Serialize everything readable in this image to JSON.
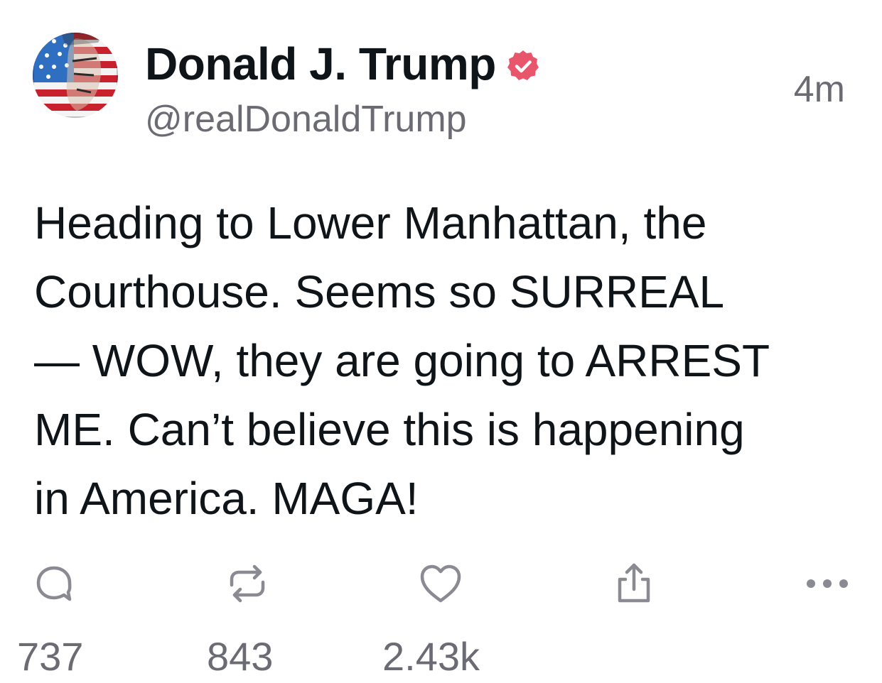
{
  "post": {
    "author_name": "Donald J. Trump",
    "handle": "@realDonaldTrump",
    "timestamp": "4m",
    "verified": true,
    "text": "Heading to Lower Manhattan, the\nCourthouse. Seems so SURREAL\n— WOW, they are going to ARREST\nME. Can’t believe this is happening\nin America. MAGA!"
  },
  "actions": {
    "reply": {
      "icon": "reply-bubble-icon",
      "count": "737"
    },
    "repost": {
      "icon": "repost-arrows-icon",
      "count": "843"
    },
    "like": {
      "icon": "heart-icon",
      "count": "2.43k"
    },
    "share": {
      "icon": "share-upload-icon"
    },
    "more": {
      "icon": "more-dots-icon"
    }
  },
  "colors": {
    "text": "#0f1419",
    "muted": "#6b6b73",
    "verified_badge": "#e8566c",
    "icon": "#8a8a93"
  }
}
